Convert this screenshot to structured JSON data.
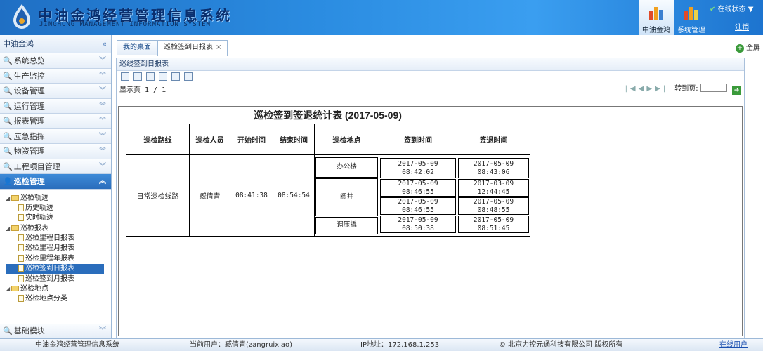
{
  "header": {
    "brand_cn": "中油金鸿经营管理信息系统",
    "brand_en": "JINGHONG MANAGEMENT INFORMATION SYSTEM",
    "tabs": [
      {
        "label": "中油金鸿",
        "active": true
      },
      {
        "label": "系统管理",
        "active": false
      }
    ],
    "user_status": "在线状态",
    "logout": "注销"
  },
  "sidebar": {
    "title": "中油金鸿",
    "sections": [
      {
        "label": "系统总览"
      },
      {
        "label": "生产监控"
      },
      {
        "label": "设备管理"
      },
      {
        "label": "运行管理"
      },
      {
        "label": "报表管理"
      },
      {
        "label": "应急指挥"
      },
      {
        "label": "物资管理"
      },
      {
        "label": "工程项目管理"
      },
      {
        "label": "巡检管理"
      }
    ],
    "tree": [
      {
        "label": "巡检轨迹",
        "type": "folder"
      },
      {
        "label": "历史轨迹",
        "type": "file"
      },
      {
        "label": "实时轨迹",
        "type": "file"
      },
      {
        "label": "巡检报表",
        "type": "folder"
      },
      {
        "label": "巡检里程日报表",
        "type": "file"
      },
      {
        "label": "巡检里程月报表",
        "type": "file"
      },
      {
        "label": "巡检里程年报表",
        "type": "file"
      },
      {
        "label": "巡检签到日报表",
        "type": "file",
        "selected": true
      },
      {
        "label": "巡检签到月报表",
        "type": "file"
      },
      {
        "label": "巡检地点",
        "type": "folder"
      },
      {
        "label": "巡检地点分类",
        "type": "file"
      }
    ],
    "bottom_section": "基础模块"
  },
  "tabs": [
    {
      "label": "我的桌面"
    },
    {
      "label": "巡检签到日报表"
    }
  ],
  "fullscreen": "全屏",
  "panel": {
    "title": "巡线签到日报表",
    "pager_text": "显示页 1 / 1",
    "goto_label": "转到页:"
  },
  "report": {
    "title": "巡检签到签退统计表 (2017-05-09)",
    "headers": [
      "巡检路线",
      "巡检人员",
      "开始时间",
      "结束时间",
      "巡检地点",
      "签到时间",
      "签退时间"
    ],
    "route": "日常巡检线路",
    "person": "臧倩青",
    "start": "08:41:38",
    "end": "08:54:54",
    "locations": [
      {
        "name": "办公楼",
        "checks": [
          {
            "in": "2017-05-09 08:42:02",
            "out_date": "2017-05-09",
            "out_time": "08:43:06"
          }
        ]
      },
      {
        "name": "阀井",
        "checks": [
          {
            "in": "2017-05-09 08:46:55",
            "out_date": "2017-03-09",
            "out_time": "12:44:45"
          },
          {
            "in": "2017-05-09 08:46:55",
            "out_date": "2017-05-09",
            "out_time": "08:48:55"
          }
        ]
      },
      {
        "name": "调压撬",
        "checks": [
          {
            "in": "2017-05-09 08:50:38",
            "out_date": "2017-05-09",
            "out_time": "08:51:45"
          }
        ]
      }
    ]
  },
  "footer": {
    "system": "中油金鸿经营管理信息系统",
    "user": "当前用户：臧倩青(zangruixiao)",
    "ip": "IP地址：172.168.1.253",
    "copyright": "© 北京力控元通科技有限公司 版权所有",
    "online": "在线用户"
  }
}
